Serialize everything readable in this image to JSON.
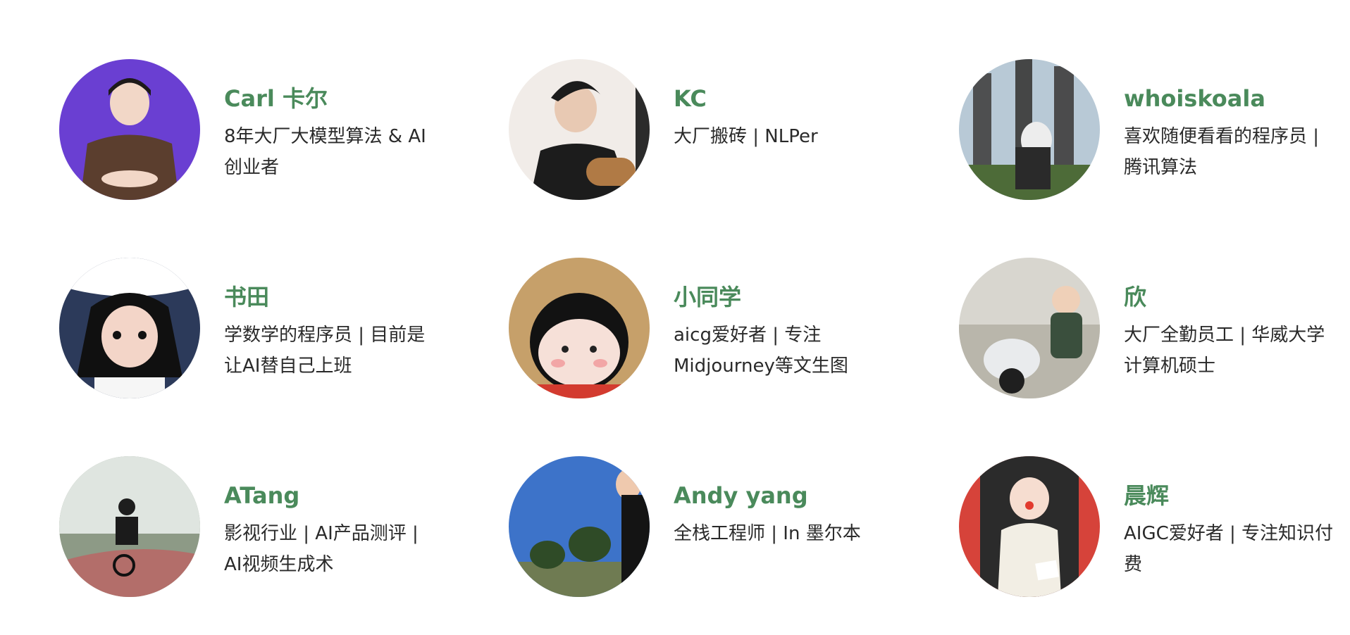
{
  "members": [
    {
      "name": "Carl 卡尔",
      "bio": "8年大厂大模型算法 & AI创业者",
      "bg": "#6a3fd2"
    },
    {
      "name": "KC",
      "bio": "大厂搬砖 | NLPer",
      "bg": "#f1ece8"
    },
    {
      "name": "whoiskoala",
      "bio": "喜欢随便看看的程序员 | 腾讯算法",
      "bg": "#b8c9d6"
    },
    {
      "name": "书田",
      "bio": "学数学的程序员 | 目前是让AI替自己上班",
      "bg": "#2c3a5a"
    },
    {
      "name": "小同学",
      "bio": "aicg爱好者 | 专注Midjourney等文生图",
      "bg": "#c6a06a"
    },
    {
      "name": "欣",
      "bio": "大厂全勤员工 | 华威大学计算机硕士",
      "bg": "#d8d6cf"
    },
    {
      "name": "ATang",
      "bio": "影视行业 | AI产品测评 | AI视频生成术",
      "bg": "#8d9a86"
    },
    {
      "name": "Andy yang",
      "bio": "全栈工程师 | In 墨尔本",
      "bg": "#3d73c9"
    },
    {
      "name": "晨辉",
      "bio": "AIGC爱好者 | 专注知识付费",
      "bg": "#d6433a"
    }
  ],
  "colors": {
    "name": "#4a8a5b",
    "bio": "#2a2a2a"
  }
}
